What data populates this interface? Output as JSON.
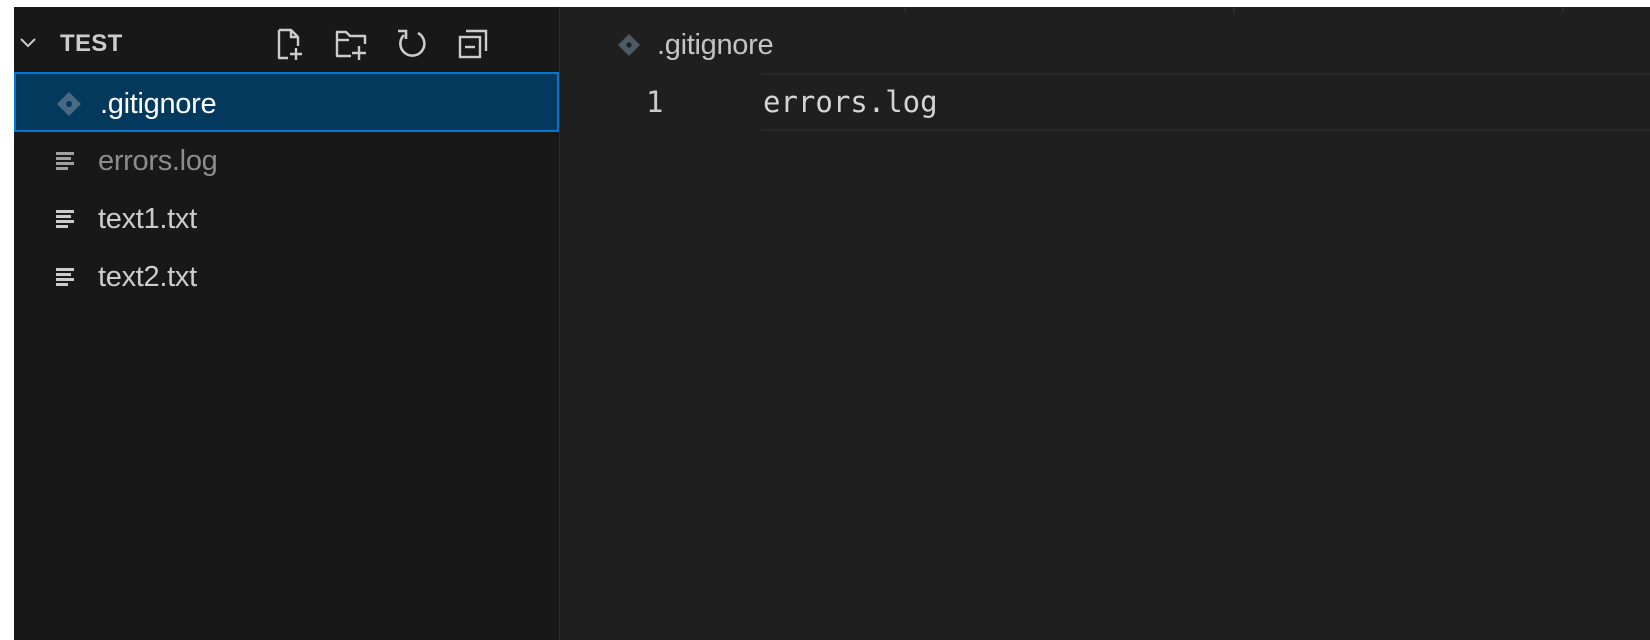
{
  "explorer": {
    "section_title": "TEST",
    "toolbar": [
      {
        "name": "new-file-icon"
      },
      {
        "name": "new-folder-icon"
      },
      {
        "name": "refresh-icon"
      },
      {
        "name": "collapse-all-icon"
      }
    ],
    "files": [
      {
        "label": ".gitignore",
        "icon": "git-diamond-icon",
        "state": "selected"
      },
      {
        "label": "errors.log",
        "icon": "text-lines-icon",
        "state": "ignored"
      },
      {
        "label": "text1.txt",
        "icon": "text-lines-icon",
        "state": "normal"
      },
      {
        "label": "text2.txt",
        "icon": "text-lines-icon",
        "state": "normal"
      }
    ]
  },
  "editor": {
    "breadcrumb": ".gitignore",
    "breadcrumb_icon": "git-diamond-icon",
    "lines": [
      {
        "number": "1",
        "text": "errors.log"
      }
    ]
  },
  "colors": {
    "selection_bg": "#04395e",
    "selection_border": "#0078d4",
    "sidebar_bg": "#181818",
    "editor_bg": "#1f1f1f",
    "ignored_text": "#8c8c8c"
  }
}
